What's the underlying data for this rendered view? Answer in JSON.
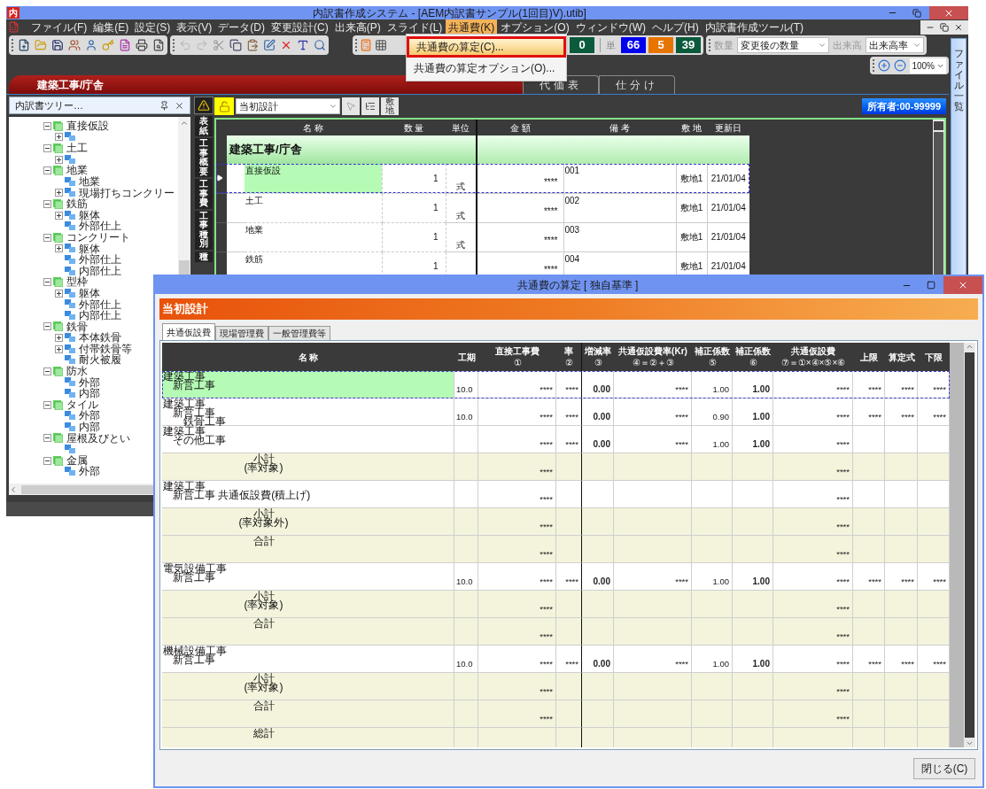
{
  "main_window": {
    "app_icon": "内",
    "title": "内訳書作成システム - [AEM内訳書サンプル(1回目)V).utib]"
  },
  "menu_bar": [
    {
      "label": "ファイル(F)",
      "selected": false
    },
    {
      "label": "編集(E)",
      "selected": false
    },
    {
      "label": "設定(S)",
      "selected": false
    },
    {
      "label": "表示(V)",
      "selected": false
    },
    {
      "label": "データ(D)",
      "selected": false
    },
    {
      "label": "変更設計(C)",
      "selected": false
    },
    {
      "label": "出来高(P)",
      "selected": false
    },
    {
      "label": "スライド(L)",
      "selected": false
    },
    {
      "label": "共通費(K)",
      "selected": true
    },
    {
      "label": "オプション(O)",
      "selected": false
    },
    {
      "label": "ウィンドウ(W)",
      "selected": false
    },
    {
      "label": "ヘルプ(H)",
      "selected": false
    },
    {
      "label": "内訳書作成ツール(T)",
      "selected": false
    }
  ],
  "dropdown_menu": [
    {
      "label": "共通費の算定(C)...",
      "selected": true
    },
    {
      "label": "共通費の算定オプション(O)...",
      "selected": false
    }
  ],
  "toolbar": {
    "counter": {
      "value": "0",
      "color": "#0b5a3c"
    },
    "unit_label": "単",
    "unit_counters": [
      {
        "value": "66",
        "color": "#0000ee"
      },
      {
        "value": "5",
        "color": "#e87400"
      },
      {
        "value": "39",
        "color": "#0b5a3c"
      }
    ],
    "quantity_label": "数量",
    "quantity_select": "変更後の数量",
    "progress_label": "出来高",
    "progress_select": "出来高率",
    "zoom": "100%"
  },
  "document_tabs": [
    {
      "label": "建築工事/庁舎",
      "selected": true
    },
    {
      "label": "代価表",
      "selected": false
    },
    {
      "label": "仕分け",
      "selected": false
    }
  ],
  "file_list_tab": "ファイル一覧",
  "tree_panel": {
    "title": "内訳書ツリー…",
    "items": [
      {
        "kind": "group",
        "label": "直接仮設",
        "expanded": true,
        "children": [
          {
            "kind": "item",
            "expanded": false
          }
        ]
      },
      {
        "kind": "group",
        "label": "土工",
        "expanded": true,
        "children": [
          {
            "kind": "item",
            "expanded": false
          }
        ]
      },
      {
        "kind": "group",
        "label": "地業",
        "expanded": true,
        "children": [
          {
            "kind": "item",
            "label": "地業"
          },
          {
            "kind": "item",
            "label": "現場打ちコンクリー",
            "expanded": false
          }
        ]
      },
      {
        "kind": "group",
        "label": "鉄筋",
        "expanded": true,
        "children": [
          {
            "kind": "item",
            "label": "躯体",
            "expanded": false
          },
          {
            "kind": "item",
            "label": "外部仕上"
          }
        ]
      },
      {
        "kind": "group",
        "label": "コンクリート",
        "expanded": true,
        "children": [
          {
            "kind": "item",
            "label": "躯体",
            "expanded": false
          },
          {
            "kind": "item",
            "label": "外部仕上"
          },
          {
            "kind": "item",
            "label": "内部仕上"
          }
        ]
      },
      {
        "kind": "group",
        "label": "型枠",
        "expanded": true,
        "children": [
          {
            "kind": "item",
            "label": "躯体",
            "expanded": false
          },
          {
            "kind": "item",
            "label": "外部仕上"
          },
          {
            "kind": "item",
            "label": "内部仕上"
          }
        ]
      },
      {
        "kind": "group",
        "label": "鉄骨",
        "expanded": true,
        "children": [
          {
            "kind": "item",
            "label": "本体鉄骨",
            "expanded": false
          },
          {
            "kind": "item",
            "label": "付帯鉄骨等",
            "expanded": false
          },
          {
            "kind": "item",
            "label": "耐火被履"
          }
        ]
      },
      {
        "kind": "group",
        "label": "防水",
        "expanded": true,
        "children": [
          {
            "kind": "item",
            "label": "外部"
          },
          {
            "kind": "item",
            "label": "内部"
          }
        ]
      },
      {
        "kind": "group",
        "label": "タイル",
        "expanded": true,
        "children": [
          {
            "kind": "item",
            "label": "外部"
          },
          {
            "kind": "item",
            "label": "内部"
          }
        ]
      },
      {
        "kind": "group",
        "label": "屋根及びとい",
        "expanded": true,
        "children": [
          {
            "kind": "item"
          }
        ]
      },
      {
        "kind": "group",
        "label": "金属",
        "expanded": true,
        "children": [
          {
            "kind": "item",
            "label": "外部"
          }
        ]
      }
    ]
  },
  "side_tabs": [
    "表紙",
    "工事概要",
    "工事費",
    "工事種別",
    "種"
  ],
  "grid": {
    "design_select": "当初設計",
    "site_button": "敷地",
    "owner": "所有者:00-99999",
    "columns": [
      "名 称",
      "数 量",
      "単位",
      "金 額",
      "備 考",
      "敷 地",
      "更新日"
    ],
    "group": "建築工事/庁舎",
    "rows": [
      {
        "name": "直接仮設",
        "qty": "1",
        "unit": "式",
        "amount": "****",
        "note": "001",
        "site": "敷地1",
        "date": "21/01/04",
        "selected": true
      },
      {
        "name": "土工",
        "qty": "1",
        "unit": "式",
        "amount": "****",
        "note": "002",
        "site": "敷地1",
        "date": "21/01/04",
        "selected": false
      },
      {
        "name": "地業",
        "qty": "1",
        "unit": "式",
        "amount": "****",
        "note": "003",
        "site": "敷地1",
        "date": "21/01/04",
        "selected": false
      },
      {
        "name": "鉄筋",
        "qty": "1",
        "amount": "****",
        "note": "004",
        "site": "敷地1",
        "date": "21/01/04",
        "selected": false
      }
    ]
  },
  "dialog": {
    "title": "共通費の算定 [ 独自基準 ]",
    "section": "当初設計",
    "tabs": [
      {
        "label": "共通仮設費",
        "selected": true
      },
      {
        "label": "現場管理費",
        "selected": false
      },
      {
        "label": "一般管理費等",
        "selected": false
      }
    ],
    "columns": [
      {
        "label": "名 称"
      },
      {
        "label": "工期",
        "kind": "period"
      },
      {
        "label": "直接工事費",
        "sub": "①",
        "kind": "amount"
      },
      {
        "label": "率",
        "sub": "②",
        "kind": "amount"
      },
      {
        "label": "増減率",
        "sub": "③",
        "kind": "strong"
      },
      {
        "label": "共通仮設費率(Kr)",
        "sub": "④＝②＋③",
        "kind": "amount"
      },
      {
        "label": "補正係数",
        "sub": "⑤",
        "kind": "amount"
      },
      {
        "label": "補正係数",
        "sub": "⑥",
        "kind": "strong"
      },
      {
        "label": "共通仮設費",
        "sub": "⑦＝①×④×⑤×⑥",
        "kind": "amount"
      },
      {
        "label": "上限",
        "kind": "amount"
      },
      {
        "label": "算定式",
        "kind": "link"
      },
      {
        "label": "下限",
        "kind": "amount"
      }
    ],
    "rows": [
      {
        "kind": "full",
        "subtotal": false,
        "selected": true,
        "lines": [
          "建築工事",
          "新営工事"
        ],
        "values": [
          "10.0",
          "****",
          "****",
          "0.00",
          "****",
          "1.00",
          "1.00",
          "****",
          "****",
          "****",
          "****"
        ]
      },
      {
        "kind": "full",
        "subtotal": false,
        "selected": false,
        "lines": [
          "建築工事",
          "新営工事",
          "鉄骨工事"
        ],
        "values": [
          "10.0",
          "****",
          "****",
          "0.00",
          "****",
          "0.90",
          "1.00",
          "****",
          "****",
          "****",
          "****"
        ]
      },
      {
        "kind": "partial",
        "subtotal": false,
        "selected": false,
        "lines": [
          "建築工事",
          "その他工事"
        ],
        "values": [
          "****",
          "****",
          "0.00",
          "****",
          "1.00",
          "1.00",
          "****"
        ]
      },
      {
        "kind": "totals",
        "subtotal": true,
        "selected": false,
        "lines": [
          "小計",
          "(率対象)"
        ],
        "values": [
          "****",
          "****"
        ]
      },
      {
        "kind": "totals",
        "subtotal": false,
        "selected": false,
        "lines": [
          "建築工事",
          "新営工事 共通仮設費(積上げ)"
        ],
        "values": [
          "****",
          "****"
        ]
      },
      {
        "kind": "totals",
        "subtotal": true,
        "selected": false,
        "lines": [
          "小計",
          "(率対象外)"
        ],
        "values": [
          "****",
          "****"
        ]
      },
      {
        "kind": "totals",
        "subtotal": true,
        "selected": false,
        "lines": [
          "合計"
        ],
        "values": [
          "****",
          "****"
        ]
      },
      {
        "kind": "full",
        "subtotal": false,
        "selected": false,
        "lines": [
          "電気設備工事",
          "新営工事"
        ],
        "values": [
          "10.0",
          "****",
          "****",
          "0.00",
          "****",
          "1.00",
          "1.00",
          "****",
          "****",
          "****",
          "****"
        ]
      },
      {
        "kind": "totals",
        "subtotal": true,
        "selected": false,
        "lines": [
          "小計",
          "(率対象)"
        ],
        "values": [
          "****",
          "****"
        ]
      },
      {
        "kind": "totals",
        "subtotal": true,
        "selected": false,
        "lines": [
          "合計"
        ],
        "values": [
          "****",
          "****"
        ]
      },
      {
        "kind": "full",
        "subtotal": false,
        "selected": false,
        "lines": [
          "機械設備工事",
          "新営工事"
        ],
        "values": [
          "10.0",
          "****",
          "****",
          "0.00",
          "****",
          "1.00",
          "1.00",
          "****",
          "****",
          "****",
          "****"
        ]
      },
      {
        "kind": "totals",
        "subtotal": true,
        "selected": false,
        "lines": [
          "小計",
          "(率対象)"
        ],
        "values": [
          "****",
          "****"
        ]
      },
      {
        "kind": "totals",
        "subtotal": true,
        "selected": false,
        "lines": [
          "合計"
        ],
        "values": [
          "****",
          "****"
        ]
      },
      {
        "kind": "totals",
        "subtotal": true,
        "selected": false,
        "lines": [
          "総計"
        ]
      }
    ],
    "close_button": "閉じる(C)"
  }
}
